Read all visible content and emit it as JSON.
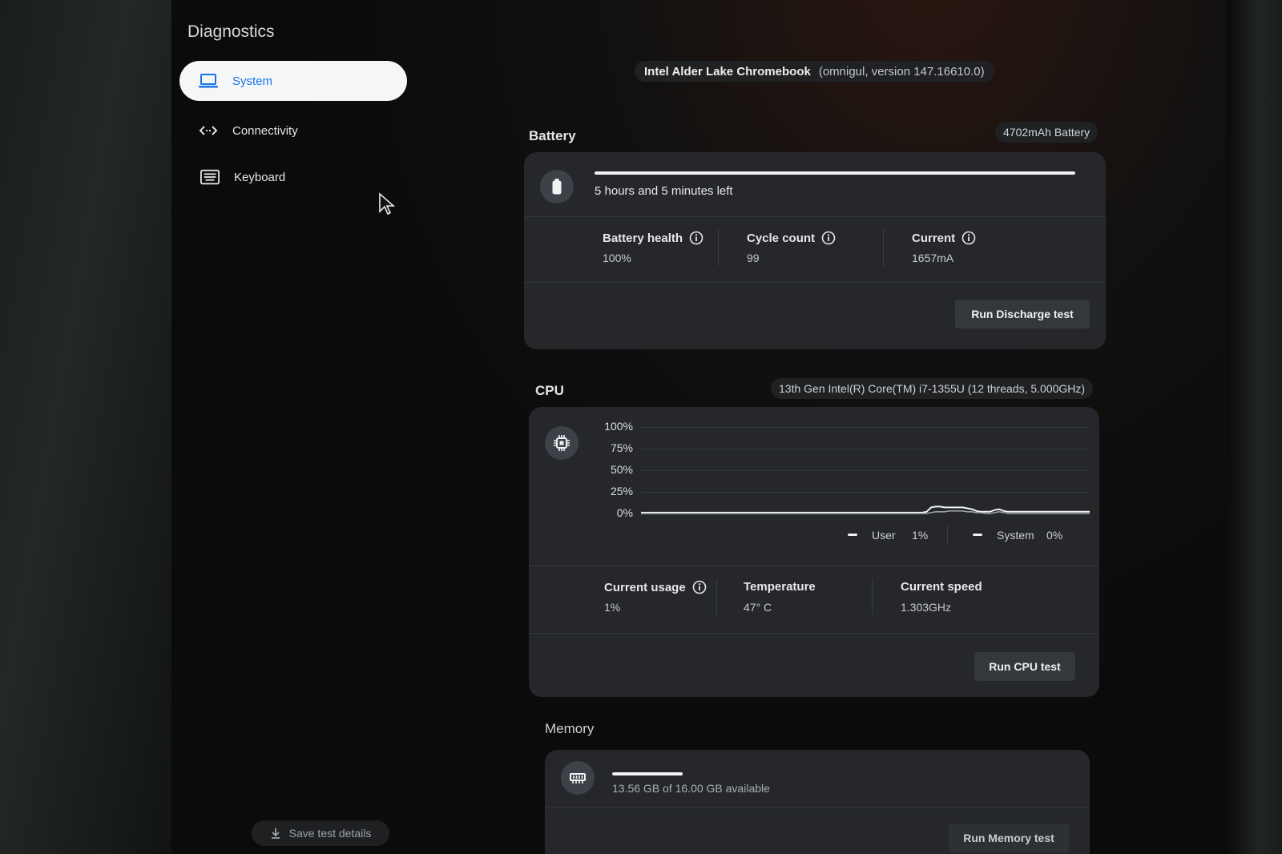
{
  "app": {
    "title": "Diagnostics"
  },
  "sidebar": {
    "items": [
      {
        "label": "System",
        "icon": "laptop-icon",
        "active": true
      },
      {
        "label": "Connectivity",
        "icon": "arrows-left-right-icon",
        "active": false
      },
      {
        "label": "Keyboard",
        "icon": "keyboard-icon",
        "active": false
      }
    ],
    "save_label": "Save test details"
  },
  "device": {
    "name": "Intel Alder Lake Chromebook",
    "version": "(omnigul, version 147.16610.0)"
  },
  "battery": {
    "title": "Battery",
    "chip": "4702mAh Battery",
    "time_left": "5 hours and 5 minutes left",
    "charge_level": 1.0,
    "health_label": "Battery health",
    "health_value": "100%",
    "cycle_label": "Cycle count",
    "cycle_value": "99",
    "current_label": "Current",
    "current_value": "1657mA",
    "button": "Run Discharge test"
  },
  "cpu": {
    "title": "CPU",
    "chip": "13th Gen Intel(R) Core(TM) i7-1355U (12 threads, 5.000GHz)",
    "user_label": "User",
    "user_value": "1%",
    "system_label": "System",
    "system_value": "0%",
    "usage_label": "Current usage",
    "usage_value": "1%",
    "temp_label": "Temperature",
    "temp_value": "47° C",
    "speed_label": "Current speed",
    "speed_value": "1.303GHz",
    "button": "Run CPU test"
  },
  "memory": {
    "title": "Memory",
    "available": "13.56 GB of 16.00 GB available",
    "used_fraction": 0.15,
    "button": "Run Memory test"
  },
  "chart_data": {
    "type": "line",
    "y_ticks": [
      "100%",
      "75%",
      "50%",
      "25%",
      "0%"
    ],
    "ylim": [
      0,
      100
    ],
    "series": [
      {
        "name": "User",
        "values": [
          1,
          1,
          1,
          1,
          1,
          1,
          1,
          1,
          1,
          1,
          1,
          1,
          1,
          1,
          1,
          1,
          1,
          1,
          1,
          1,
          1,
          1,
          1,
          1,
          1,
          1,
          1,
          1,
          1,
          1,
          1,
          1,
          1,
          1,
          1,
          1,
          1,
          1,
          1,
          1,
          1,
          1,
          1,
          1,
          1,
          1,
          1,
          1,
          1,
          1,
          1,
          1,
          1,
          1,
          1,
          1,
          1,
          1,
          1,
          1,
          1,
          1,
          1,
          2,
          7,
          8,
          8,
          7,
          7,
          7,
          7,
          7,
          6,
          5,
          3,
          2,
          2,
          2,
          4,
          5,
          3,
          2,
          2,
          2,
          2,
          2,
          2,
          2,
          2,
          2,
          2,
          2,
          2,
          2,
          2,
          2,
          2,
          2,
          2,
          2
        ]
      },
      {
        "name": "System",
        "values": [
          0,
          0,
          0,
          0,
          0,
          0,
          0,
          0,
          0,
          0,
          0,
          0,
          0,
          0,
          0,
          0,
          0,
          0,
          0,
          0,
          0,
          0,
          0,
          0,
          0,
          0,
          0,
          0,
          0,
          0,
          0,
          0,
          0,
          0,
          0,
          0,
          0,
          0,
          0,
          0,
          0,
          0,
          0,
          0,
          0,
          0,
          0,
          0,
          0,
          0,
          0,
          0,
          0,
          0,
          0,
          0,
          0,
          0,
          0,
          0,
          0,
          0,
          0,
          0,
          1,
          2,
          2,
          2,
          3,
          3,
          3,
          3,
          2,
          2,
          1,
          1,
          0,
          0,
          1,
          2,
          1,
          0,
          0,
          0,
          0,
          0,
          0,
          0,
          0,
          0,
          0,
          0,
          0,
          0,
          0,
          0,
          0,
          0,
          0,
          0
        ]
      }
    ]
  }
}
